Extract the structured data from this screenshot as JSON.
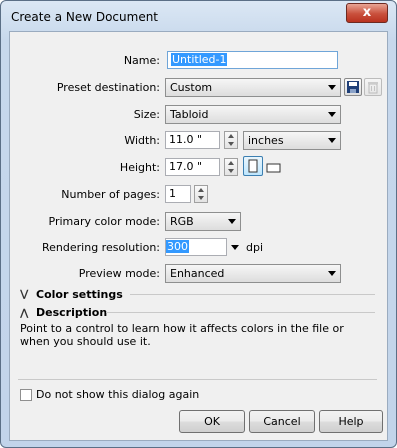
{
  "window": {
    "title": "Create a New Document",
    "close_symbol": "x"
  },
  "form": {
    "name_label": "Name:",
    "name_value": "Untitled-1",
    "preset_label": "Preset destination:",
    "preset_value": "Custom",
    "size_label": "Size:",
    "size_value": "Tabloid",
    "width_label": "Width:",
    "width_value": "11.0 \"",
    "units_value": "inches",
    "height_label": "Height:",
    "height_value": "17.0 \"",
    "pages_label": "Number of pages:",
    "pages_value": "1",
    "color_mode_label": "Primary color mode:",
    "color_mode_value": "RGB",
    "resolution_label": "Rendering resolution:",
    "resolution_value": "300",
    "resolution_unit": "dpi",
    "preview_label": "Preview mode:",
    "preview_value": "Enhanced"
  },
  "sections": {
    "color_settings": "Color settings",
    "description": "Description",
    "description_text": "Point to a control to learn how it affects colors in the file or when you should use it."
  },
  "footer": {
    "dont_show_label": "Do not show this dialog again",
    "ok_label": "OK",
    "cancel_label": "Cancel",
    "help_label": "Help"
  }
}
